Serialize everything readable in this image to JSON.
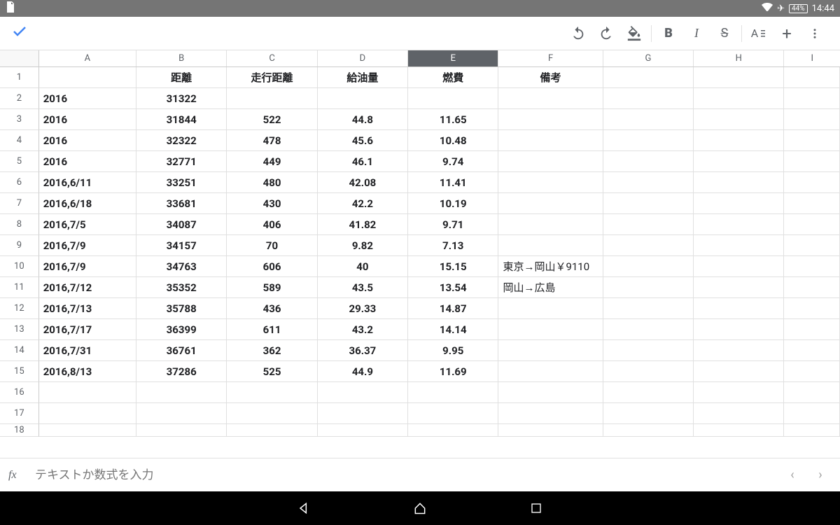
{
  "status": {
    "battery": "44%",
    "time": "14:44"
  },
  "toolbar": {},
  "columns": [
    "A",
    "B",
    "C",
    "D",
    "E",
    "F",
    "G",
    "H",
    "I"
  ],
  "selectedCol": "E",
  "rows": [
    {
      "n": 1,
      "a": "",
      "b": "距離",
      "c": "走行距離",
      "d": "給油量",
      "e": "燃費",
      "f": "備考",
      "g": "",
      "h": "",
      "i": "",
      "header": true
    },
    {
      "n": 2,
      "a": "2016",
      "b": "31322",
      "c": "",
      "d": "",
      "e": "",
      "f": "",
      "g": "",
      "h": "",
      "i": ""
    },
    {
      "n": 3,
      "a": "2016",
      "b": "31844",
      "c": "522",
      "d": "44.8",
      "e": "11.65",
      "f": "",
      "g": "",
      "h": "",
      "i": ""
    },
    {
      "n": 4,
      "a": "2016",
      "b": "32322",
      "c": "478",
      "d": "45.6",
      "e": "10.48",
      "f": "",
      "g": "",
      "h": "",
      "i": ""
    },
    {
      "n": 5,
      "a": "2016",
      "b": "32771",
      "c": "449",
      "d": "46.1",
      "e": "9.74",
      "f": "",
      "g": "",
      "h": "",
      "i": ""
    },
    {
      "n": 6,
      "a": "2016,6/11",
      "b": "33251",
      "c": "480",
      "d": "42.08",
      "e": "11.41",
      "f": "",
      "g": "",
      "h": "",
      "i": ""
    },
    {
      "n": 7,
      "a": "2016,6/18",
      "b": "33681",
      "c": "430",
      "d": "42.2",
      "e": "10.19",
      "f": "",
      "g": "",
      "h": "",
      "i": ""
    },
    {
      "n": 8,
      "a": "2016,7/5",
      "b": "34087",
      "c": "406",
      "d": "41.82",
      "e": "9.71",
      "f": "",
      "g": "",
      "h": "",
      "i": ""
    },
    {
      "n": 9,
      "a": "2016,7/9",
      "b": "34157",
      "c": "70",
      "d": "9.82",
      "e": "7.13",
      "f": "",
      "g": "",
      "h": "",
      "i": ""
    },
    {
      "n": 10,
      "a": "2016,7/9",
      "b": "34763",
      "c": "606",
      "d": "40",
      "e": "15.15",
      "f": "東京→岡山￥9110",
      "g": "",
      "h": "",
      "i": ""
    },
    {
      "n": 11,
      "a": "2016,7/12",
      "b": "35352",
      "c": "589",
      "d": "43.5",
      "e": "13.54",
      "f": "岡山→広島",
      "g": "",
      "h": "",
      "i": ""
    },
    {
      "n": 12,
      "a": "2016,7/13",
      "b": "35788",
      "c": "436",
      "d": "29.33",
      "e": "14.87",
      "f": "",
      "g": "",
      "h": "",
      "i": ""
    },
    {
      "n": 13,
      "a": "2016,7/17",
      "b": "36399",
      "c": "611",
      "d": "43.2",
      "e": "14.14",
      "f": "",
      "g": "",
      "h": "",
      "i": ""
    },
    {
      "n": 14,
      "a": "2016,7/31",
      "b": "36761",
      "c": "362",
      "d": "36.37",
      "e": "9.95",
      "f": "",
      "g": "",
      "h": "",
      "i": ""
    },
    {
      "n": 15,
      "a": "2016,8/13",
      "b": "37286",
      "c": "525",
      "d": "44.9",
      "e": "11.69",
      "f": "",
      "g": "",
      "h": "",
      "i": ""
    },
    {
      "n": 16,
      "a": "",
      "b": "",
      "c": "",
      "d": "",
      "e": "",
      "f": "",
      "g": "",
      "h": "",
      "i": ""
    },
    {
      "n": 17,
      "a": "",
      "b": "",
      "c": "",
      "d": "",
      "e": "",
      "f": "",
      "g": "",
      "h": "",
      "i": ""
    },
    {
      "n": 18,
      "a": "",
      "b": "",
      "c": "",
      "d": "",
      "e": "",
      "f": "",
      "g": "",
      "h": "",
      "i": ""
    }
  ],
  "fx": {
    "label": "fx",
    "placeholder": "テキストか数式を入力"
  }
}
